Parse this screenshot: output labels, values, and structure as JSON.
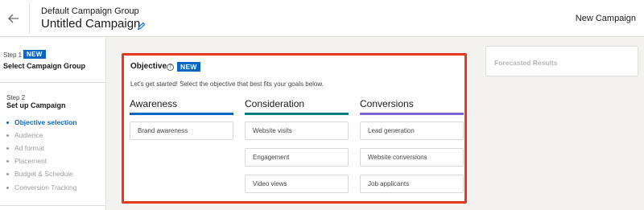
{
  "header": {
    "group_name": "Default Campaign Group",
    "campaign_name": "Untitled Campaign",
    "new_campaign_label": "New Campaign",
    "icons": {
      "back": "arrow-left-icon",
      "edit": "pencil-icon"
    }
  },
  "sidebar": {
    "step1": {
      "label": "Step 1",
      "badge": "NEW",
      "title": "Select Campaign Group"
    },
    "step2": {
      "label": "Step 2",
      "title": "Set up Campaign",
      "substeps": [
        {
          "label": "Objective selection",
          "active": true
        },
        {
          "label": "Audience",
          "active": false
        },
        {
          "label": "Ad format",
          "active": false
        },
        {
          "label": "Placement",
          "active": false
        },
        {
          "label": "Budget & Schedule",
          "active": false
        },
        {
          "label": "Conversion Tracking",
          "active": false
        }
      ]
    }
  },
  "objective": {
    "title": "Objective",
    "badge": "NEW",
    "help_icon": "question-circle-icon",
    "subtitle": "Let's get started! Select the objective that best fits your goals below.",
    "columns": [
      {
        "heading": "Awareness",
        "color": "#0a66c2",
        "options": [
          "Brand awareness"
        ]
      },
      {
        "heading": "Consideration",
        "color": "#057e8c",
        "options": [
          "Website visits",
          "Engagement",
          "Video views"
        ]
      },
      {
        "heading": "Conversions",
        "color": "#7c64d6",
        "options": [
          "Lead generation",
          "Website conversions",
          "Job applicants"
        ]
      }
    ]
  },
  "forecast": {
    "title": "Forecasted Results"
  },
  "colors": {
    "accent": "#0a66c2",
    "highlight_border": "#e8381c"
  }
}
